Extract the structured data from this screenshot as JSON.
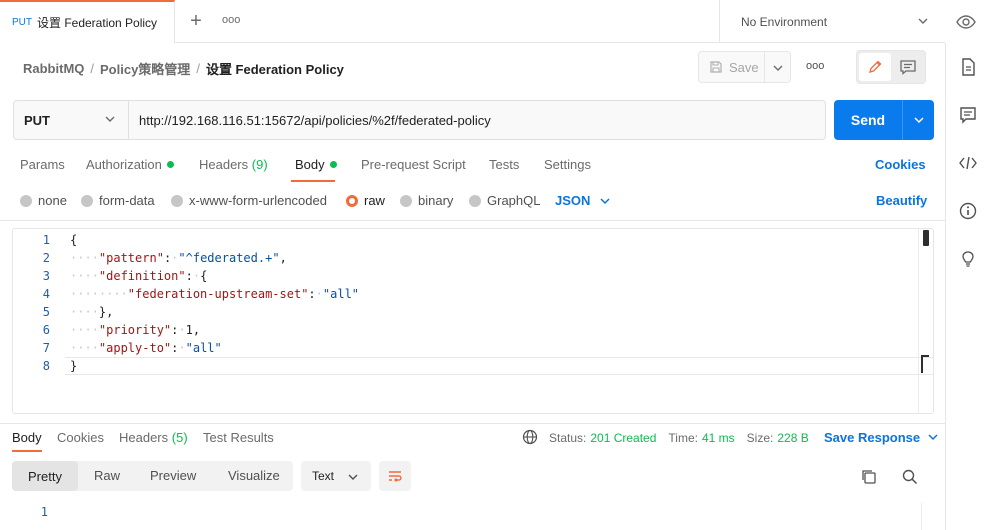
{
  "tabs": {
    "active": {
      "method": "PUT",
      "title": "设置 Federation Policy"
    },
    "new_tab": "+",
    "more": "ooo"
  },
  "environment": {
    "selected": "No Environment"
  },
  "breadcrumb": {
    "items": [
      "RabbitMQ",
      "Policy策略管理"
    ],
    "separator": "/",
    "current": "设置 Federation Policy"
  },
  "toolbar": {
    "save_label": "Save",
    "more": "ooo"
  },
  "request": {
    "method": "PUT",
    "url": "http://192.168.116.51:15672/api/policies/%2f/federated-policy",
    "send_label": "Send"
  },
  "request_tabs": {
    "params": "Params",
    "authorization": "Authorization",
    "headers": "Headers",
    "headers_count": "(9)",
    "body": "Body",
    "prerequest": "Pre-request Script",
    "tests": "Tests",
    "settings": "Settings",
    "cookies": "Cookies"
  },
  "body_types": {
    "none": "none",
    "form_data": "form-data",
    "urlencoded": "x-www-form-urlencoded",
    "raw": "raw",
    "binary": "binary",
    "graphql": "GraphQL",
    "format": "JSON",
    "beautify": "Beautify"
  },
  "editor": {
    "line_numbers": [
      "1",
      "2",
      "3",
      "4",
      "5",
      "6",
      "7",
      "8"
    ],
    "lines": {
      "l1": "{",
      "l2_key": "\"pattern\"",
      "l2_val": "\"^federated.+\"",
      "l3_key": "\"definition\"",
      "l3_rest": "{",
      "l4_key": "\"federation-upstream-set\"",
      "l4_val": "\"all\"",
      "l5": "},",
      "l6_key": "\"priority\"",
      "l6_val": "1,",
      "l7_key": "\"apply-to\"",
      "l7_val": "\"all\"",
      "l8": "}"
    }
  },
  "response": {
    "tabs": {
      "body": "Body",
      "cookies": "Cookies",
      "headers": "Headers",
      "headers_count": "(5)",
      "test_results": "Test Results"
    },
    "status_label": "Status:",
    "status_value": "201 Created",
    "time_label": "Time:",
    "time_value": "41 ms",
    "size_label": "Size:",
    "size_value": "228 B",
    "save_response": "Save Response",
    "views": {
      "pretty": "Pretty",
      "raw": "Raw",
      "preview": "Preview",
      "visualize": "Visualize"
    },
    "format": "Text",
    "line_number": "1"
  },
  "colors": {
    "accent": "#f26b3a",
    "primary": "#097bed",
    "link": "#0b74de",
    "success": "#0cbb52"
  }
}
